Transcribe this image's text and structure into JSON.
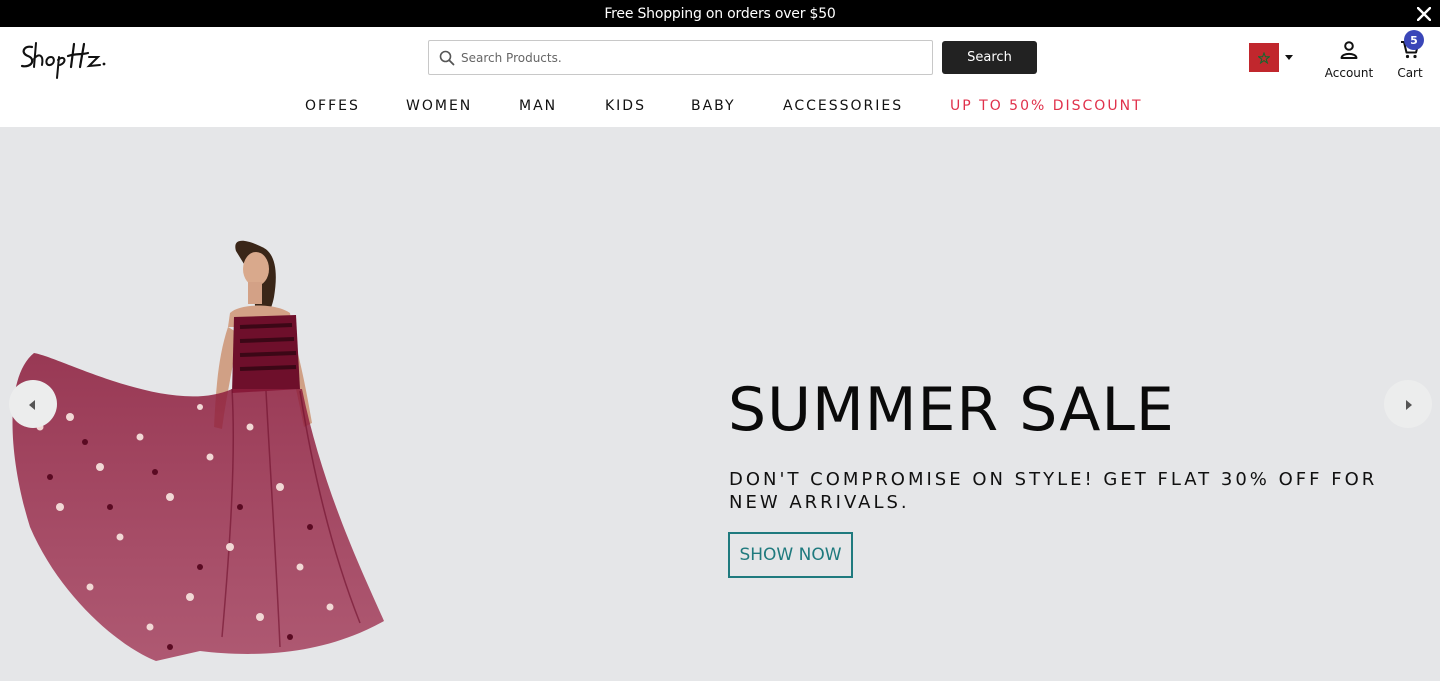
{
  "announcement": {
    "text": "Free Shopping on orders over $50",
    "close_icon": "close-icon"
  },
  "header": {
    "logo_text": "ShopHz",
    "search": {
      "placeholder": "Search Products.",
      "value": "",
      "button_label": "Search"
    },
    "country": {
      "flag": "morocco-flag",
      "flag_color": "#c1272d"
    },
    "account_label": "Account",
    "cart_label": "Cart",
    "cart_count": "5"
  },
  "nav": {
    "items": [
      "OFFES",
      "WOMEN",
      "MAN",
      "KIDS",
      "BABY",
      "ACCESSORIES"
    ],
    "discount": "UP TO 50% DISCOUNT"
  },
  "hero": {
    "title": "SUMMER SALE",
    "subtitle": "DON'T COMPROMISE ON STYLE! GET FLAT 30% OFF FOR NEW ARRIVALS.",
    "button_label": "SHOW NOW",
    "background": "#e5e6e8",
    "accent": "#1f7a7e"
  },
  "colors": {
    "discount": "#e0314b",
    "badge": "#3a46b8",
    "search_button": "#222222"
  }
}
